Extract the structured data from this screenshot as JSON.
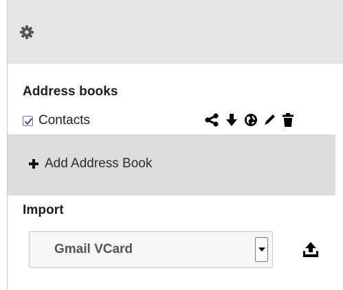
{
  "header": {
    "settings_icon": "gear-icon"
  },
  "address_books": {
    "title": "Address books",
    "items": [
      {
        "label": "Contacts",
        "checked": true,
        "actions": [
          "share-icon",
          "download-icon",
          "globe-icon",
          "pencil-icon",
          "trash-icon"
        ]
      }
    ],
    "add_label": "Add Address Book"
  },
  "import": {
    "title": "Import",
    "selected": "Gmail VCard",
    "upload_icon": "upload-icon"
  },
  "colors": {
    "header_bg": "#e6e6e6",
    "add_bar_bg": "#dcdcdc",
    "checkbox_check": "#3d4fb3",
    "icon": "#000000"
  }
}
